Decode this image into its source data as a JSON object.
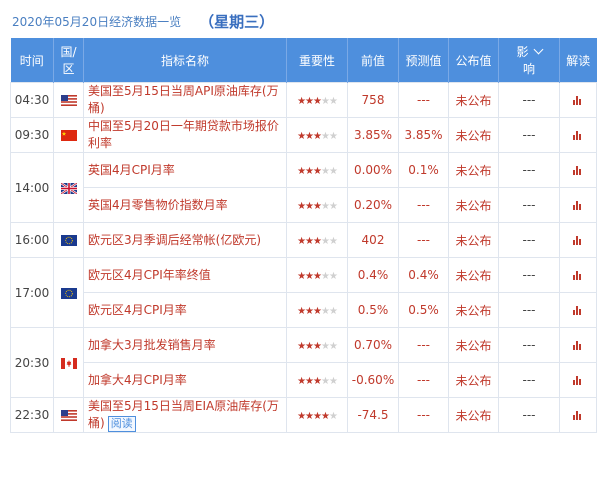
{
  "header": {
    "date": "2020年05月20日经济数据一览",
    "weekday": "（星期三）"
  },
  "columns": {
    "time": "时间",
    "region_l1": "国/",
    "region_l2": "区",
    "indicator": "指标名称",
    "importance": "重要性",
    "previous": "前值",
    "forecast": "预测值",
    "actual": "公布值",
    "impact_l1": "影",
    "impact_l2": "响",
    "explain": "解读"
  },
  "rows": [
    {
      "time": "04:30",
      "flag": "US-flag",
      "indicator": "美国至5月15日当周API原油库存(万桶)",
      "stars": 3,
      "previous": "758",
      "forecast": "---",
      "actual": "未公布",
      "impact": "---"
    },
    {
      "time": "09:30",
      "flag": "China-flag",
      "indicator": "中国至5月20日一年期贷款市场报价利率",
      "stars": 3,
      "previous": "3.85%",
      "forecast": "3.85%",
      "actual": "未公布",
      "impact": "---"
    },
    {
      "time": "14:00",
      "flag": "UK-flag",
      "indicator": "英国4月CPI月率",
      "stars": 3,
      "previous": "0.00%",
      "forecast": "0.1%",
      "actual": "未公布",
      "impact": "---"
    },
    {
      "time": "",
      "flag": "",
      "indicator": "英国4月零售物价指数月率",
      "stars": 3,
      "previous": "0.20%",
      "forecast": "---",
      "actual": "未公布",
      "impact": "---"
    },
    {
      "time": "16:00",
      "flag": "EU-flag",
      "indicator": "欧元区3月季调后经常帐(亿欧元)",
      "stars": 3,
      "previous": "402",
      "forecast": "---",
      "actual": "未公布",
      "impact": "---"
    },
    {
      "time": "17:00",
      "flag": "EU-flag",
      "indicator": "欧元区4月CPI年率终值",
      "stars": 3,
      "previous": "0.4%",
      "forecast": "0.4%",
      "actual": "未公布",
      "impact": "---"
    },
    {
      "time": "",
      "flag": "",
      "indicator": "欧元区4月CPI月率",
      "stars": 3,
      "previous": "0.5%",
      "forecast": "0.5%",
      "actual": "未公布",
      "impact": "---"
    },
    {
      "time": "20:30",
      "flag": "Canada-flag",
      "indicator": "加拿大3月批发销售月率",
      "stars": 3,
      "previous": "0.70%",
      "forecast": "---",
      "actual": "未公布",
      "impact": "---"
    },
    {
      "time": "",
      "flag": "",
      "indicator": "加拿大4月CPI月率",
      "stars": 3,
      "previous": "-0.60%",
      "forecast": "---",
      "actual": "未公布",
      "impact": "---"
    },
    {
      "time": "22:30",
      "flag": "US-flag",
      "indicator": "美国至5月15日当周EIA原油库存(万桶)",
      "read_label": "阅读",
      "stars": 4,
      "previous": "-74.5",
      "forecast": "---",
      "actual": "未公布",
      "impact": "---"
    }
  ],
  "colors": {
    "header_bg": "#4e8fdd",
    "value_red": "#c0392b",
    "star_gray": "#d0d0d0"
  },
  "icons": {
    "star": "star-icon",
    "explain": "bar-chart-icon",
    "sort": "chevron-down-icon"
  }
}
